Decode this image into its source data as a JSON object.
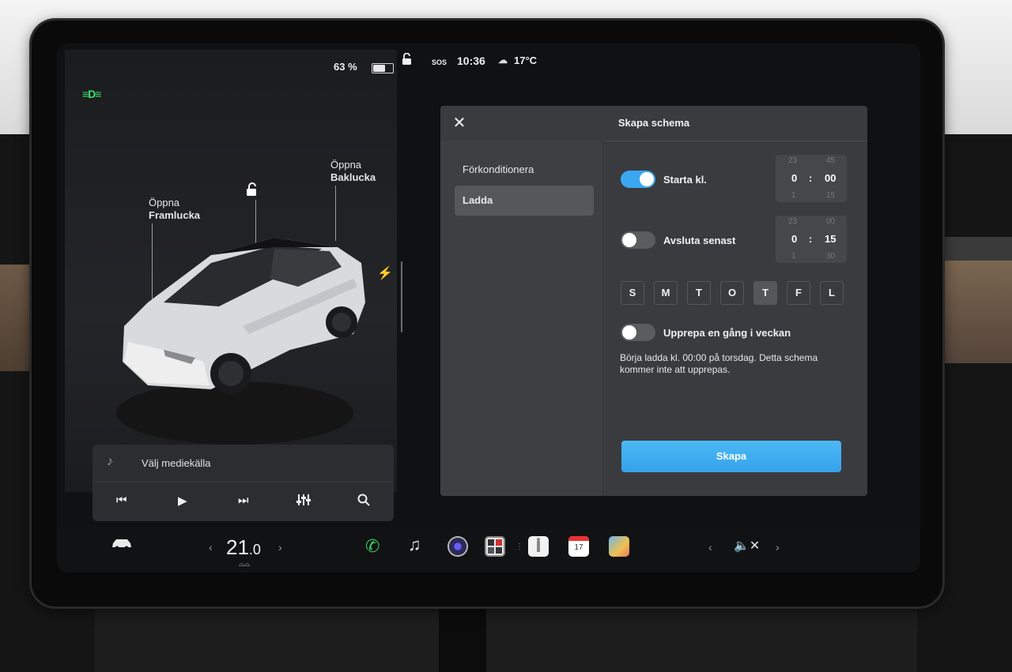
{
  "status_bar": {
    "battery_percent": "63 %",
    "battery_level": 0.63,
    "sos": "SOS",
    "time": "10:36",
    "temperature": "17°C"
  },
  "car_panel": {
    "front_trunk": {
      "line1": "Öppna",
      "line2": "Framlucka"
    },
    "rear_trunk": {
      "line1": "Öppna",
      "line2": "Baklucka"
    }
  },
  "media": {
    "source_label": "Välj mediekälla"
  },
  "dialog": {
    "title": "Skapa schema",
    "side_items": [
      "Förkonditionera",
      "Ladda"
    ],
    "active_side_item": 1,
    "start": {
      "label": "Starta kl.",
      "enabled": true,
      "picker": {
        "prev_hour": "23",
        "prev_min": "45",
        "hour": "0",
        "min": "00",
        "next_hour": "1",
        "next_min": "15"
      }
    },
    "end": {
      "label": "Avsluta senast",
      "enabled": false,
      "picker": {
        "prev_hour": "23",
        "prev_min": "00",
        "hour": "0",
        "min": "15",
        "next_hour": "1",
        "next_min": "30"
      }
    },
    "days": [
      "S",
      "M",
      "T",
      "O",
      "T",
      "F",
      "L"
    ],
    "selected_day": 4,
    "repeat": {
      "label": "Upprepa en gång i veckan",
      "enabled": false
    },
    "summary": "Börja ladda kl. 00:00 på torsdag. Detta schema kommer inte att upprepas.",
    "create_label": "Skapa",
    "accent": "#3aa7f0"
  },
  "bottom_bar": {
    "temperature_whole": "21",
    "temperature_decimal": ".0",
    "calendar_day": "17"
  }
}
